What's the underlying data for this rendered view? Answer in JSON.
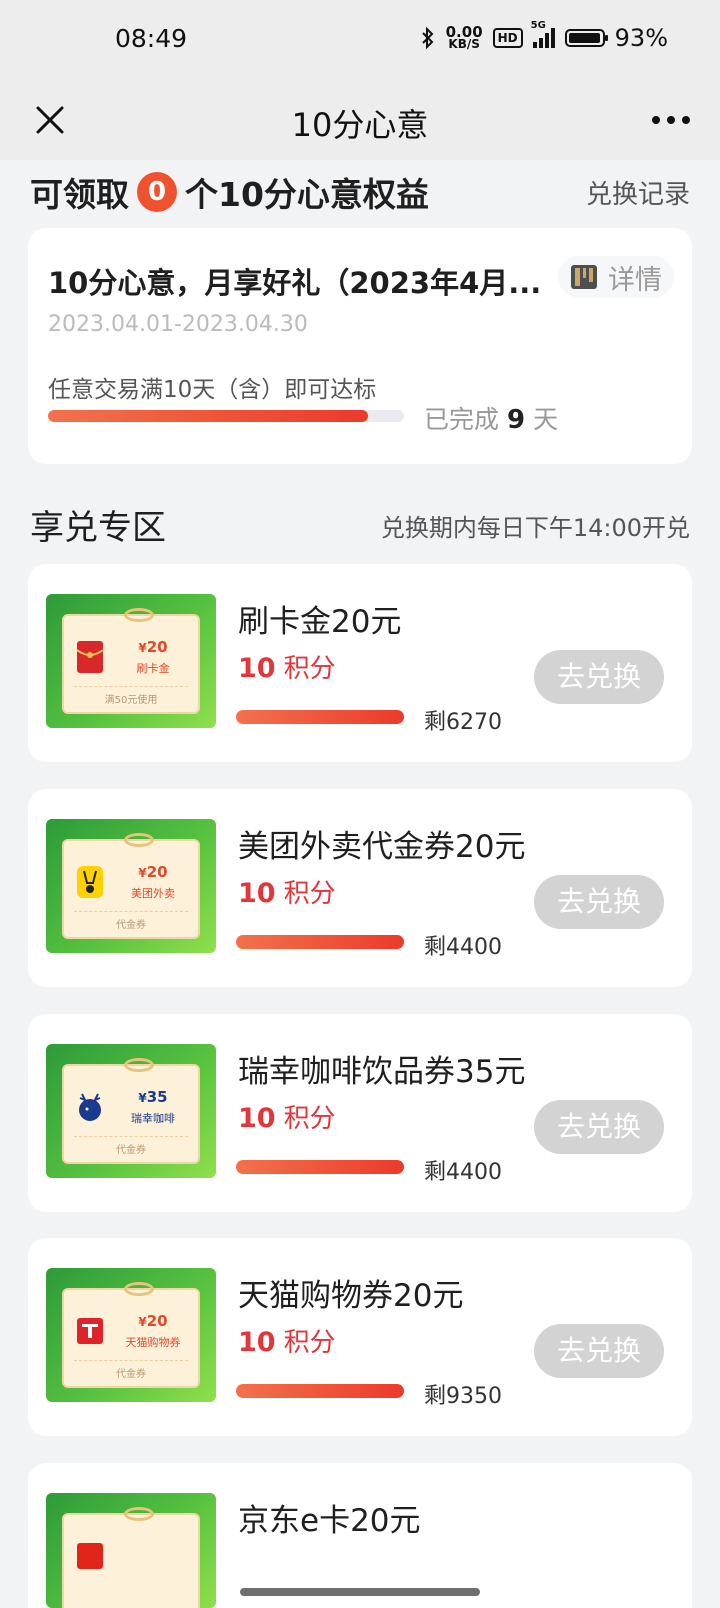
{
  "status_bar": {
    "time": "08:49",
    "net_speed_value": "0.00",
    "net_speed_unit": "KB/S",
    "hd": "HD",
    "network": "5G",
    "battery": "93%",
    "icons": [
      "bluetooth-icon",
      "signal-icon",
      "battery-icon"
    ]
  },
  "nav": {
    "title": "10分心意",
    "close_icon": "close-icon",
    "more_icon": "more-icon"
  },
  "benefits": {
    "prefix": "可领取",
    "count": "0",
    "suffix": "个10分心意权益",
    "record_link": "兑换记录"
  },
  "campaign": {
    "title": "10分心意，月享好礼（2023年4月...",
    "detail_label": "详情",
    "date_range": "2023.04.01-2023.04.30",
    "rule": "任意交易满10天（含）即可达标",
    "progress_fraction": 0.9,
    "progress_prefix": "已完成",
    "progress_days": "9",
    "progress_suffix": "天"
  },
  "section": {
    "title": "享兑专区",
    "note": "兑换期内每日下午14:00开兑"
  },
  "products": [
    {
      "name": "刷卡金20元",
      "points": "10",
      "points_unit": "积分",
      "stock": "剩6270",
      "button": "去兑换",
      "coupon_amount": "20",
      "coupon_name": "刷卡金",
      "coupon_foot": "满50元使用",
      "logo": "red-envelope-icon"
    },
    {
      "name": "美团外卖代金券20元",
      "points": "10",
      "points_unit": "积分",
      "stock": "剩4400",
      "button": "去兑换",
      "coupon_amount": "20",
      "coupon_name": "美团外卖",
      "coupon_foot": "代金券",
      "logo": "meituan-kangaroo-icon"
    },
    {
      "name": "瑞幸咖啡饮品券35元",
      "points": "10",
      "points_unit": "积分",
      "stock": "剩4400",
      "button": "去兑换",
      "coupon_amount": "35",
      "coupon_name": "瑞幸咖啡",
      "coupon_foot": "代金券",
      "logo": "luckin-deer-icon"
    },
    {
      "name": "天猫购物券20元",
      "points": "10",
      "points_unit": "积分",
      "stock": "剩9350",
      "button": "去兑换",
      "coupon_amount": "20",
      "coupon_name": "天猫购物券",
      "coupon_foot": "代金券",
      "logo": "tmall-icon"
    },
    {
      "name": "京东e卡20元",
      "logo": "jd-icon"
    }
  ],
  "currency_symbol": "¥",
  "colors": {
    "accent_red": "#e1373a",
    "badge_orange": "#f0522f",
    "progress_start": "#f2724d",
    "progress_end": "#ec3a2a",
    "disabled_button": "#d3d3d3",
    "thumb_green": "#55c13f"
  }
}
